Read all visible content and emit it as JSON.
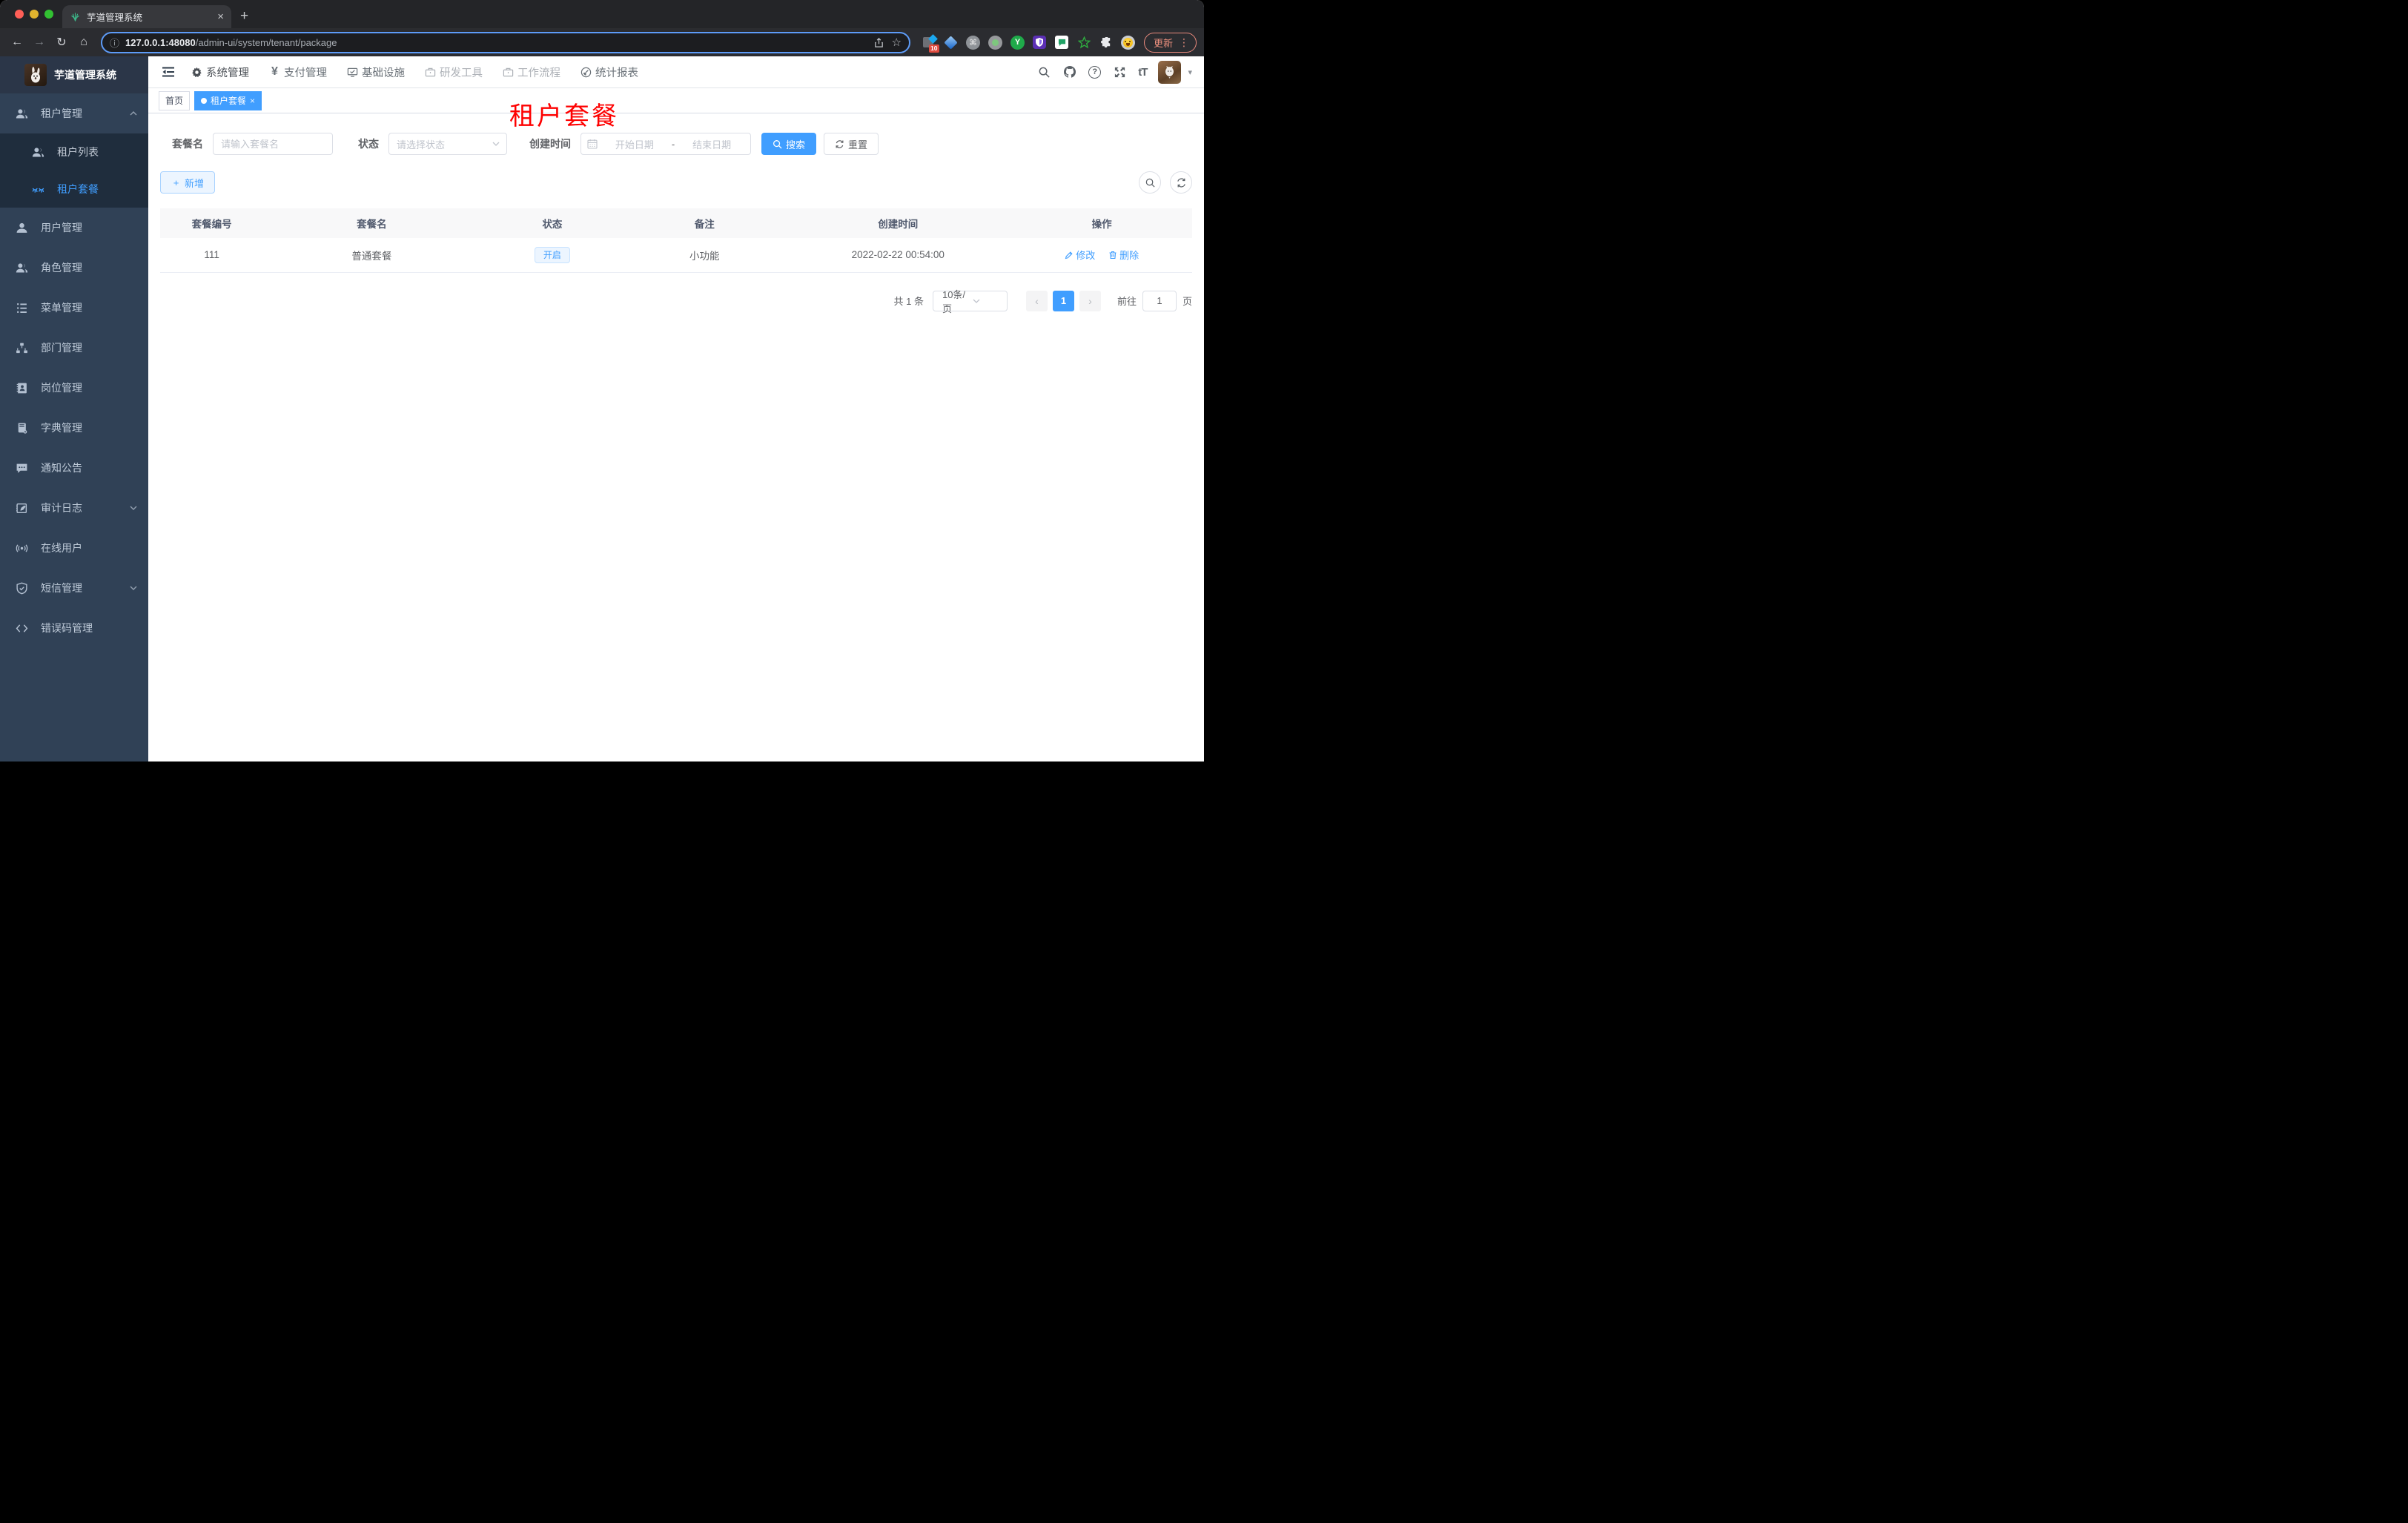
{
  "browser": {
    "tab": {
      "title": "芋道管理系统"
    },
    "omnibox": {
      "host": "127.0.0.1:48080",
      "path": "/admin-ui/system/tenant/package"
    },
    "extensions_badge": "10",
    "update_button": "更新"
  },
  "icons": {
    "back": "←",
    "forward": "→",
    "reload": "↻",
    "home": "⌂",
    "info": "ⓘ",
    "star": "☆",
    "newtab_plus": "+",
    "tab_close": "×",
    "kebab": "⋮",
    "caret_down": "▾",
    "question": "?",
    "font_size": "tT",
    "yen": "¥",
    "cmd": "⌘",
    "y_letter": "Y",
    "prev": "‹",
    "next": "›",
    "tag_close": "×",
    "add_plus": "+"
  },
  "app": {
    "logo_title": "芋道管理系统",
    "topnav": [
      {
        "label": "系统管理"
      },
      {
        "label": "支付管理"
      },
      {
        "label": "基础设施"
      },
      {
        "label": "研发工具"
      },
      {
        "label": "工作流程"
      },
      {
        "label": "统计报表"
      }
    ],
    "sidebar": {
      "items": [
        {
          "label": "租户管理"
        },
        {
          "label": "租户列表"
        },
        {
          "label": "租户套餐"
        },
        {
          "label": "用户管理"
        },
        {
          "label": "角色管理"
        },
        {
          "label": "菜单管理"
        },
        {
          "label": "部门管理"
        },
        {
          "label": "岗位管理"
        },
        {
          "label": "字典管理"
        },
        {
          "label": "通知公告"
        },
        {
          "label": "审计日志"
        },
        {
          "label": "在线用户"
        },
        {
          "label": "短信管理"
        },
        {
          "label": "错误码管理"
        }
      ]
    },
    "tags": {
      "home": "首页",
      "active": "租户套餐"
    },
    "page_title": "租户套餐",
    "filter": {
      "name_label": "套餐名",
      "name_placeholder": "请输入套餐名",
      "status_label": "状态",
      "status_placeholder": "请选择状态",
      "date_label": "创建时间",
      "date_start": "开始日期",
      "date_sep": "-",
      "date_end": "结束日期",
      "search": "搜索",
      "reset": "重置"
    },
    "toolbar": {
      "add": "新增"
    },
    "table": {
      "headers": [
        "套餐编号",
        "套餐名",
        "状态",
        "备注",
        "创建时间",
        "操作"
      ],
      "rows": [
        {
          "id": "111",
          "name": "普通套餐",
          "status": "开启",
          "remark": "小功能",
          "created": "2022-02-22 00:54:00",
          "edit": "修改",
          "delete": "删除"
        }
      ]
    },
    "pagination": {
      "total": "共 1 条",
      "page_size": "10条/页",
      "page": "1",
      "goto": "前往",
      "goto_value": "1",
      "unit": "页"
    },
    "colors": {
      "accent": "#409eff",
      "title_red": "#fe0000",
      "sidebar": "#304156"
    }
  }
}
